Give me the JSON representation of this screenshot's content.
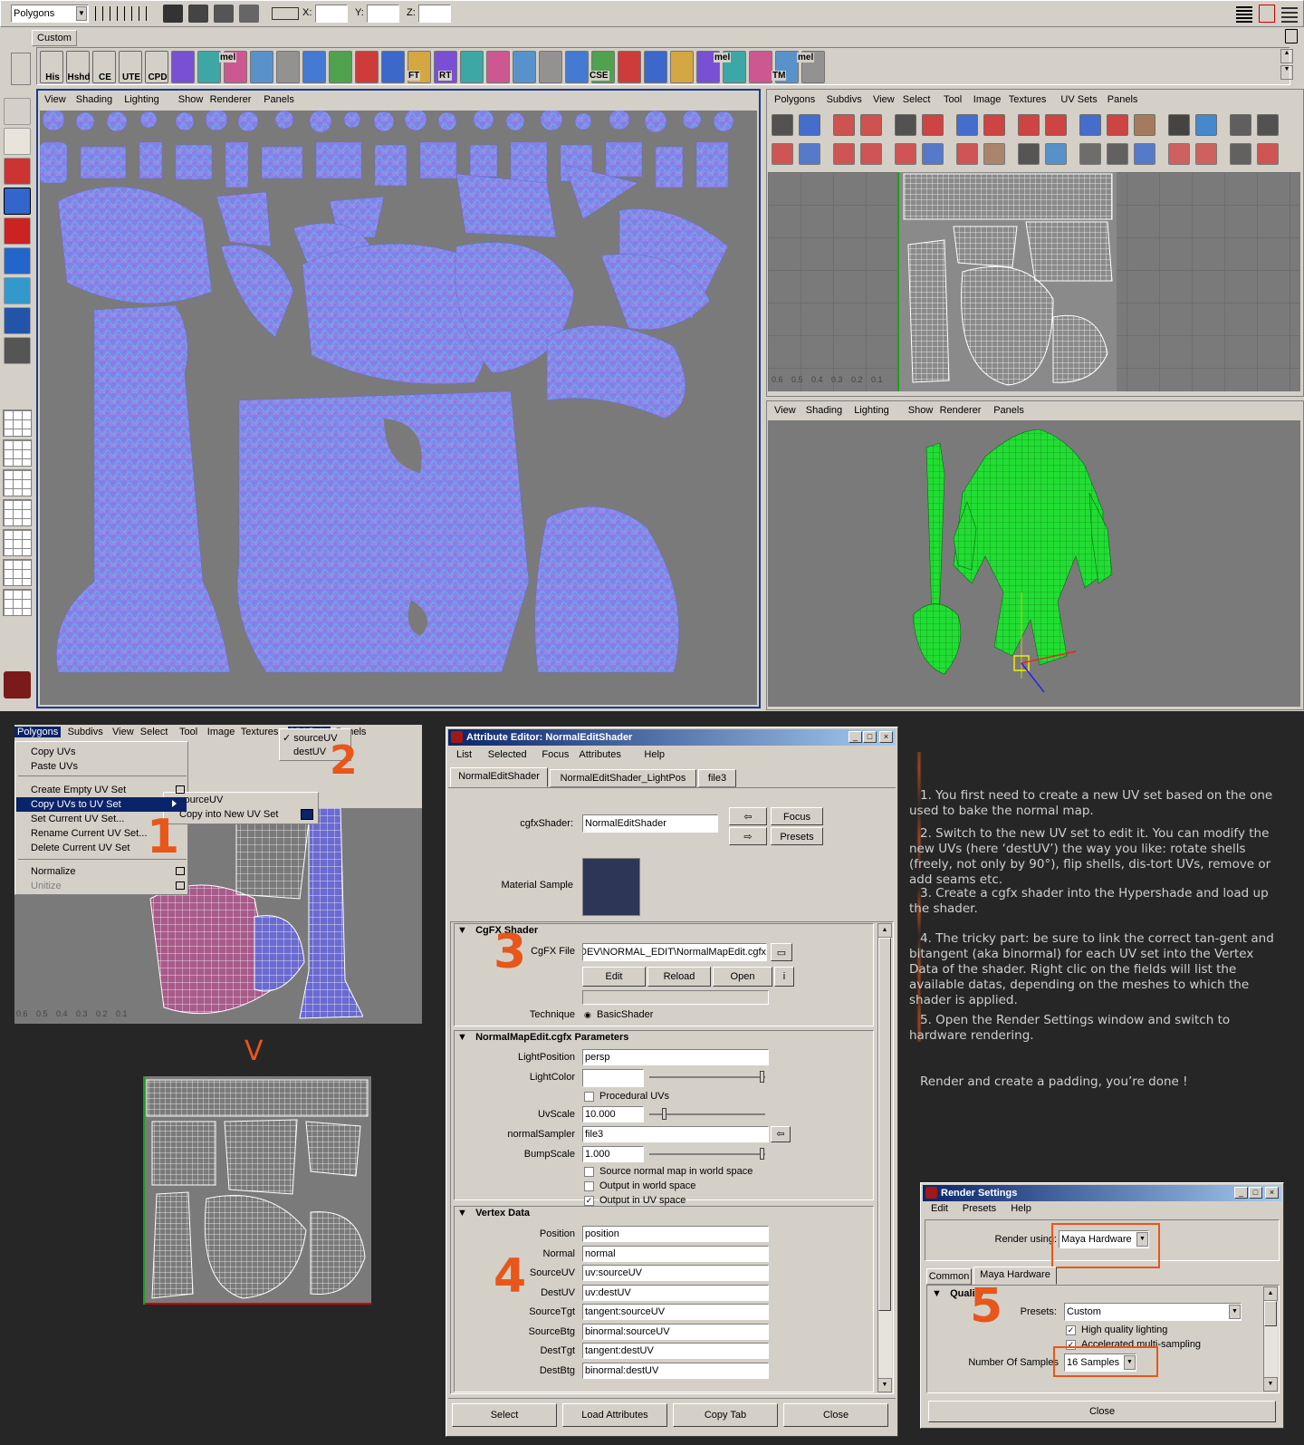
{
  "maya": {
    "mode_dropdown": "Polygons",
    "coord_labels": [
      "X:",
      "Y:",
      "Z:"
    ],
    "shelf_tab": "Custom",
    "shelf_labels": [
      "His",
      "Hshd",
      "CE",
      "UTE",
      "CPD",
      "mel",
      "FT",
      "RT",
      "CSE",
      "mel",
      "TM",
      "mel"
    ],
    "left_menu": [
      "View",
      "Shading",
      "Lighting",
      "Show",
      "Renderer",
      "Panels"
    ],
    "uv_menu": [
      "Polygons",
      "Subdivs",
      "View",
      "Select",
      "Tool",
      "Image",
      "Textures",
      "UV Sets",
      "Panels"
    ],
    "persp_menu": [
      "View",
      "Shading",
      "Lighting",
      "Show",
      "Renderer",
      "Panels"
    ],
    "uv_axis_labels": [
      "0.6",
      "0.5",
      "0.4",
      "0.3",
      "0.2",
      "0.1"
    ]
  },
  "uvsets_menu": {
    "menubar": [
      "Polygons",
      "Subdivs",
      "View",
      "Select",
      "Tool",
      "Image",
      "Textures",
      "UV Sets",
      "Panels"
    ],
    "items": [
      "Copy UVs",
      "Paste UVs",
      "Create Empty UV Set",
      "Copy UVs to UV Set",
      "Set Current UV Set...",
      "Rename Current UV Set...",
      "Delete Current UV Set",
      "Normalize",
      "Unitize"
    ],
    "submenu": [
      "sourceUV",
      "Copy into New UV Set"
    ],
    "uvset_list": [
      "sourceUV",
      "destUV"
    ],
    "step1": "1",
    "step2": "2",
    "arrow": "V",
    "axis_labels": [
      "0.6",
      "0.5",
      "0.4",
      "0.3",
      "0.2",
      "0.1"
    ]
  },
  "attr_editor": {
    "title": "Attribute Editor: NormalEditShader",
    "menu": [
      "List",
      "Selected",
      "Focus",
      "Attributes",
      "Help"
    ],
    "tabs": [
      "NormalEditShader",
      "NormalEditShader_LightPos",
      "file3"
    ],
    "cgfx_label": "cgfxShader:",
    "cgfx_value": "NormalEditShader",
    "focus": "Focus",
    "presets": "Presets",
    "material_sample": "Material Sample",
    "section_cgfx": "CgFX Shader",
    "cgfx_file_label": "CgFX File",
    "cgfx_file_value": "DEV\\NORMAL_EDIT\\NormalMapEdit.cgfx",
    "edit": "Edit",
    "reload": "Reload",
    "open": "Open",
    "technique_label": "Technique",
    "technique_value": "BasicShader",
    "section_params": "NormalMapEdit.cgfx Parameters",
    "light_position_label": "LightPosition",
    "light_position_value": "persp",
    "light_color_label": "LightColor",
    "procedural_uvs": "Procedural UVs",
    "uvscale_label": "UvScale",
    "uvscale_value": "10.000",
    "normal_sampler_label": "normalSampler",
    "normal_sampler_value": "file3",
    "bumpscale_label": "BumpScale",
    "bumpscale_value": "1.000",
    "chk_source_world": "Source normal map in world space",
    "chk_output_world": "Output in world space",
    "chk_output_uv": "Output in UV space",
    "section_vertex": "Vertex Data",
    "vertex_rows": [
      {
        "label": "Position",
        "value": "position"
      },
      {
        "label": "Normal",
        "value": "normal"
      },
      {
        "label": "SourceUV",
        "value": "uv:sourceUV"
      },
      {
        "label": "DestUV",
        "value": "uv:destUV"
      },
      {
        "label": "SourceTgt",
        "value": "tangent:sourceUV"
      },
      {
        "label": "SourceBtg",
        "value": "binormal:sourceUV"
      },
      {
        "label": "DestTgt",
        "value": "tangent:destUV"
      },
      {
        "label": "DestBtg",
        "value": "binormal:destUV"
      }
    ],
    "bottom_buttons": [
      "Select",
      "Load Attributes",
      "Copy Tab",
      "Close"
    ],
    "step3": "3",
    "step4": "4"
  },
  "instructions": {
    "steps": [
      "1. You first need to create a new UV set based on the one used to bake the normal map.",
      "2. Switch to the new UV set to edit it. You can modify the new UVs (here ‘destUV’) the way you like: rotate shells (freely, not only by 90°), flip shells, dis-tort UVs, remove or add seams etc.",
      "3. Create a cgfx shader into the Hypershade and load up the shader.",
      "4. The tricky part: be sure to link the correct tan-gent and bitangent (aka binormal) for each UV set into the Vertex Data of the shader. Right clic on the fields will list the available datas, depending on the meshes to which the shader is applied.",
      "5. Open the Render Settings window and switch to hardware rendering."
    ],
    "footer": "Render and create a padding, you’re done !"
  },
  "render_settings": {
    "title": "Render Settings",
    "menu": [
      "Edit",
      "Presets",
      "Help"
    ],
    "render_using_label": "Render using:",
    "render_using_value": "Maya Hardware",
    "tabs": [
      "Common",
      "Maya Hardware"
    ],
    "section_quality": "Quality",
    "presets_label": "Presets:",
    "presets_value": "Custom",
    "chk_high_quality": "High quality lighting",
    "chk_accelerated": "Accelerated multi-sampling",
    "samples_label": "Number Of Samples",
    "samples_value": "16 Samples",
    "close": "Close",
    "step5": "5"
  },
  "colors": {
    "highlight": "#e8561a",
    "window_bg": "#d4d0c8",
    "viewport_gray": "#808080",
    "menu_select": "#0a246a"
  }
}
